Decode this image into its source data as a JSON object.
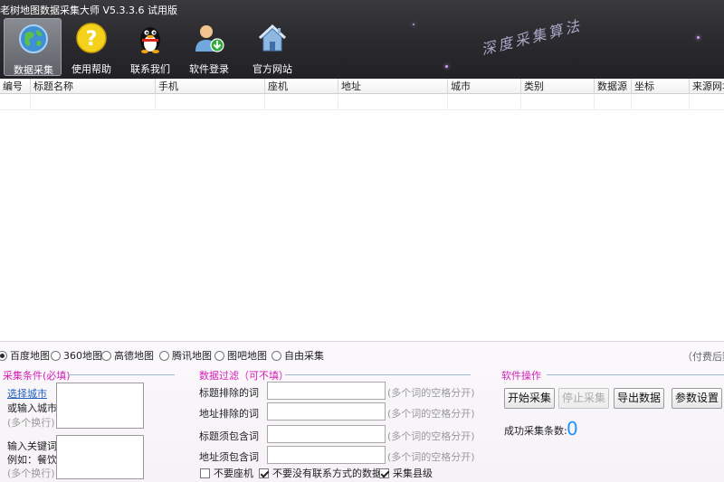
{
  "window": {
    "title": "老树地图数据采集大师 V5.3.3.6 试用版"
  },
  "watermark": "深度采集算法",
  "toolbar": [
    {
      "label": "数据采集",
      "icon": "globe-icon",
      "active": true
    },
    {
      "label": "使用帮助",
      "icon": "help-icon"
    },
    {
      "label": "联系我们",
      "icon": "qq-penguin-icon"
    },
    {
      "label": "软件登录",
      "icon": "user-login-icon"
    },
    {
      "label": "官方网站",
      "icon": "home-icon"
    }
  ],
  "grid": {
    "columns": [
      "编号",
      "标题名称",
      "手机",
      "座机",
      "地址",
      "城市",
      "类别",
      "数据源",
      "坐标",
      "来源网址"
    ]
  },
  "map_sources": {
    "options": [
      "百度地图",
      "360地图",
      "高德地图",
      "腾讯地图",
      "图吧地图",
      "自由采集"
    ],
    "selected": "百度地图",
    "pay_note": "（付费后数据"
  },
  "conditions": {
    "title": "采集条件(必填)",
    "select_city_link": "选择城市",
    "city_label": "或输入城市",
    "city_hint": "(多个换行)",
    "keyword_label": "输入关键词",
    "keyword_example": "例如：餐饮",
    "keyword_hint": "(多个换行)",
    "city_value": "",
    "keyword_value": ""
  },
  "filters": {
    "title": "数据过滤（可不填）",
    "rows": [
      {
        "label": "标题排除的词",
        "value": "",
        "hint": "(多个词的空格分开)"
      },
      {
        "label": "地址排除的词",
        "value": "",
        "hint": "(多个词的空格分开)"
      },
      {
        "label": "标题须包含词",
        "value": "",
        "hint": "(多个词的空格分开)"
      },
      {
        "label": "地址须包含词",
        "value": "",
        "hint": "(多个词的空格分开)"
      }
    ],
    "checkboxes": [
      {
        "label": "不要座机",
        "checked": false
      },
      {
        "label": "不要没有联系方式的数据",
        "checked": true
      },
      {
        "label": "采集县级",
        "checked": true
      }
    ]
  },
  "operations": {
    "title": "软件操作",
    "buttons": [
      {
        "label": "开始采集",
        "enabled": true
      },
      {
        "label": "停止采集",
        "enabled": false
      },
      {
        "label": "导出数据",
        "enabled": true
      },
      {
        "label": "参数设置",
        "enabled": true
      }
    ],
    "count_label": "成功采集条数:",
    "count_value": "0"
  },
  "colors": {
    "accent": "#d21fb6",
    "count": "#1e90ff",
    "link": "#1f5fbf"
  }
}
